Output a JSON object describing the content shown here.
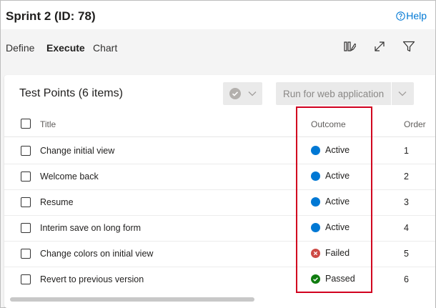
{
  "header": {
    "title": "Sprint 2 (ID: 78)",
    "help_label": "Help"
  },
  "tabs": [
    {
      "label": "Define",
      "active": false
    },
    {
      "label": "Execute",
      "active": true
    },
    {
      "label": "Chart",
      "active": false
    }
  ],
  "toolbar_icons": [
    "column-options-icon",
    "expand-icon",
    "filter-icon"
  ],
  "panel": {
    "title": "Test Points (6 items)",
    "run_button_label": "Run for web application",
    "columns": {
      "title": "Title",
      "outcome": "Outcome",
      "order": "Order"
    },
    "rows": [
      {
        "title": "Change initial view",
        "outcome": "Active",
        "status": "active",
        "order": "1"
      },
      {
        "title": "Welcome back",
        "outcome": "Active",
        "status": "active",
        "order": "2"
      },
      {
        "title": "Resume",
        "outcome": "Active",
        "status": "active",
        "order": "3"
      },
      {
        "title": "Interim save on long form",
        "outcome": "Active",
        "status": "active",
        "order": "4"
      },
      {
        "title": "Change colors on initial view",
        "outcome": "Failed",
        "status": "failed",
        "order": "5"
      },
      {
        "title": "Revert to previous version",
        "outcome": "Passed",
        "status": "passed",
        "order": "6"
      }
    ]
  },
  "colors": {
    "accent": "#0078d4",
    "active": "#0078d4",
    "failed": "#cd4a45",
    "passed": "#107c10",
    "highlight": "#d1001f"
  }
}
